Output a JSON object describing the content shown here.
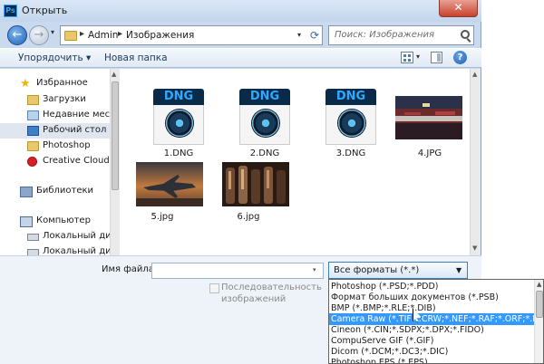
{
  "window": {
    "title": "Открыть",
    "app_icon_text": "Ps",
    "close_label": "✕"
  },
  "address": {
    "sep1": "▸",
    "crumb1": "Admin",
    "sep2": "▸",
    "crumb2": "Изображения",
    "search_placeholder": "Поиск: Изображения"
  },
  "toolbar": {
    "organize_label": "Упорядочить ▾",
    "new_folder_label": "Новая папка",
    "help_label": "?"
  },
  "sidebar": {
    "favorites": "Избранное",
    "items": [
      {
        "label": "Загрузки"
      },
      {
        "label": "Недавние места"
      },
      {
        "label": "Рабочий стол"
      },
      {
        "label": "Photoshop"
      },
      {
        "label": "Creative Cloud Files"
      }
    ],
    "libraries": "Библиотеки",
    "computer": "Компьютер",
    "disks": [
      {
        "label": "Локальный диск"
      },
      {
        "label": "Локальный диск"
      }
    ]
  },
  "files": [
    {
      "name": "1.DNG",
      "kind": "dng",
      "badge": "DNG"
    },
    {
      "name": "2.DNG",
      "kind": "dng",
      "badge": "DNG"
    },
    {
      "name": "3.DNG",
      "kind": "dng",
      "badge": "DNG"
    },
    {
      "name": "4.JPG",
      "kind": "photo"
    },
    {
      "name": "5.jpg",
      "kind": "photo"
    },
    {
      "name": "6.jpg",
      "kind": "photo"
    }
  ],
  "bottom": {
    "filename_label": "Имя файла:",
    "filename_value": "",
    "sequence_label_line1": "Последовательность",
    "sequence_label_line2": "изображений",
    "format_selected": "Все форматы (*.*)"
  },
  "format_options": [
    "Photoshop (*.PSD;*.PDD)",
    "Формат больших документов (*.PSB)",
    "BMP (*.BMP;*.RLE;*.DIB)",
    "Camera Raw (*.TIF;*.CRW;*.NEF;*.RAF;*.ORF;*.MRW;",
    "Cineon (*.CIN;*.SDPX;*.DPX;*.FIDO)",
    "CompuServe GIF (*.GIF)",
    "Dicom (*.DCM;*.DC3;*.DIC)",
    "Photoshop EPS (*.EPS)"
  ],
  "format_highlighted_index": 3
}
